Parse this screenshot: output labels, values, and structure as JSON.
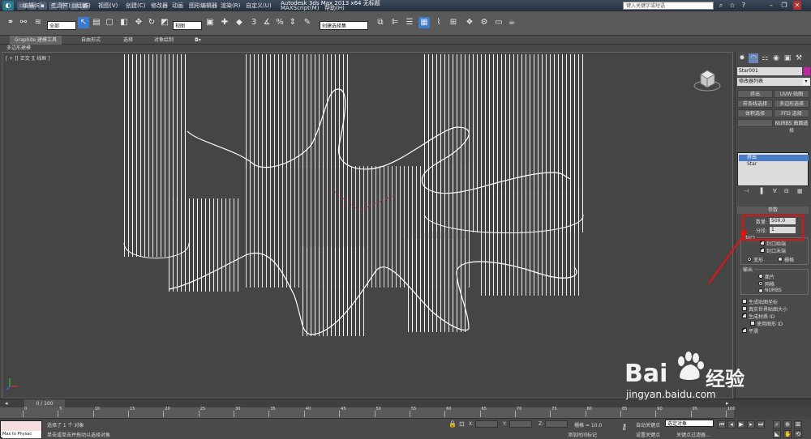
{
  "window": {
    "title": "Autodesk 3ds Max  2013 x64      无标题",
    "help_search_placeholder": "键入关键字或短语"
  },
  "menu": [
    "编辑(E)",
    "工具(T)",
    "组(G)",
    "视图(V)",
    "创建(C)",
    "修改器",
    "动画",
    "图形编辑器",
    "渲染(R)",
    "自定义(U)",
    "MAXScript(M)",
    "帮助(H)"
  ],
  "toolbar": {
    "selection_filter": "全部",
    "reference_coord": "视图",
    "named_selection": "创建选择集"
  },
  "ribbon": {
    "tabs": [
      "Graphite 建模工具",
      "自由形式",
      "选择",
      "对象绘制"
    ],
    "sub_label": "多边形建模"
  },
  "viewport": {
    "label": "[ + ][ 正交 ][ 线框 ]"
  },
  "command_panel": {
    "object_name": "Star001",
    "object_color": "#c820a8",
    "modifier_list": "修改器列表",
    "modifier_buttons": [
      "挤出",
      "UVW 贴图",
      "样条线选择",
      "多边形选择",
      "体积选择",
      "FFD 选择",
      "",
      "NURBS 曲面选择"
    ],
    "stack": [
      "挤出",
      "Star"
    ],
    "parameters": {
      "title": "参数",
      "amount_label": "数量:",
      "amount_value": "500.0",
      "segments_label": "分段:",
      "segments_value": "1",
      "capping_title": "封口",
      "cap_start": "封口始端",
      "cap_end": "封口末端",
      "morph": "变形",
      "grid": "栅格",
      "output_title": "输出",
      "patch": "面片",
      "mesh": "网格",
      "nurbs": "NURBS",
      "gen_mapping": "生成贴图坐标",
      "real_world": "真实世界贴图大小",
      "gen_material_ids": "生成材质 ID",
      "use_shape_ids": "使用图形 ID",
      "smooth": "平滑"
    }
  },
  "timeline": {
    "frame_display": "0 / 100",
    "ticks": [
      0,
      5,
      10,
      15,
      20,
      25,
      30,
      35,
      40,
      45,
      50,
      55,
      60,
      65,
      70,
      75,
      80,
      85,
      90,
      95,
      100
    ]
  },
  "status": {
    "maxscript_label": "Max to Physac",
    "selected_text": "选择了 1 个 对象",
    "prompt_text": "单击或单击并拖动以选择对象",
    "x_label": "X:",
    "y_label": "Y:",
    "z_label": "Z:",
    "grid_text": "栅格 = 10.0",
    "add_time_tag": "添加时间标记",
    "auto_key": "自动关键点",
    "set_key": "设置关键点",
    "key_selected": "选定对象",
    "key_filters": "关键点过滤器..."
  },
  "watermark": {
    "brand": "Bai",
    "brand_suffix": "经验",
    "url": "jingyan.baidu.com"
  }
}
